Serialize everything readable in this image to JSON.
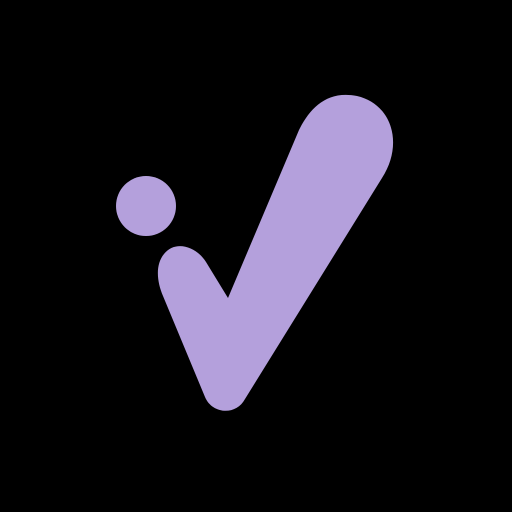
{
  "app_icon": {
    "icon_name": "check-mark-logo-icon",
    "background_color": "#000000",
    "mark_color": "#B4A0DC"
  }
}
